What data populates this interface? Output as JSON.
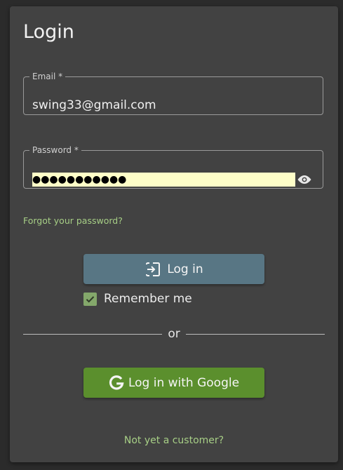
{
  "login_card": {
    "title": "Login",
    "email": {
      "label": "Email *",
      "value": "swing33@gmail.com"
    },
    "password": {
      "label": "Password *",
      "masked_value": "●●●●●●●●●●●"
    },
    "forgot_password_link": "Forgot your password?",
    "login_button": {
      "label": "Log in",
      "icon": "login-icon"
    },
    "remember_me": {
      "label": "Remember me",
      "checked": true
    },
    "divider_text": "or",
    "google_button": {
      "label": "Log in with Google",
      "icon": "google-icon"
    },
    "signup_link": "Not yet a customer?"
  },
  "colors": {
    "page_background": "#2b2b2b",
    "card_background": "#424242",
    "login_button": "#587684",
    "google_button": "#5b8f2d",
    "link": "#a7cf86",
    "checkbox": "#84a86b",
    "autofill_background": "#fefec8"
  }
}
